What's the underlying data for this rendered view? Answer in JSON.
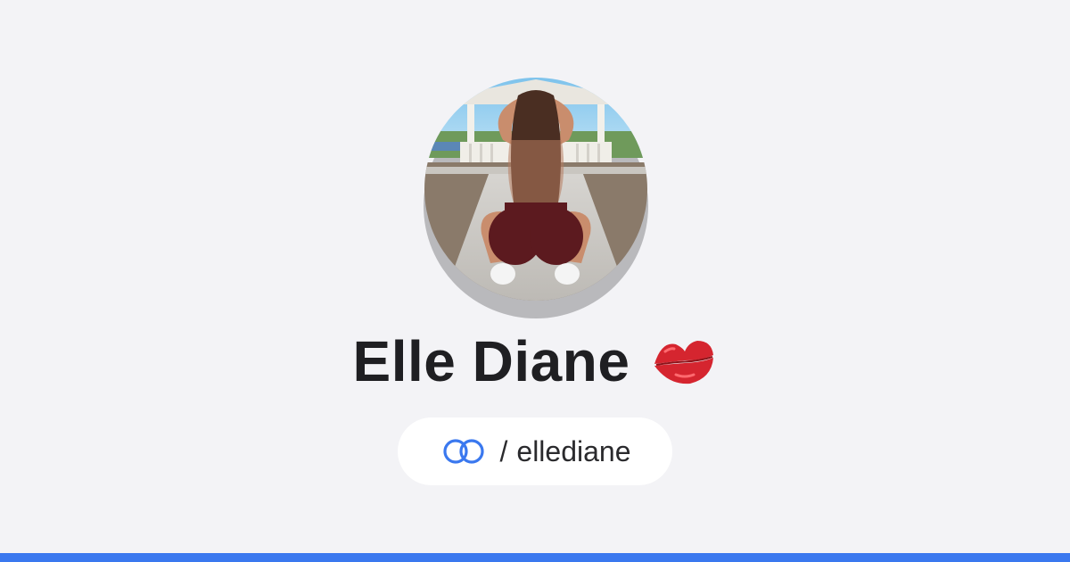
{
  "profile": {
    "name": "Elle Diane",
    "emoji": "💋",
    "emoji_name": "kiss-mark-icon",
    "handle_prefix": "/",
    "handle": "ellediane",
    "link_icon_name": "link-rings-icon"
  },
  "colors": {
    "background": "#f3f3f6",
    "accent": "#3a78ef",
    "name_text": "#1f1f22",
    "pill_background": "#ffffff"
  }
}
